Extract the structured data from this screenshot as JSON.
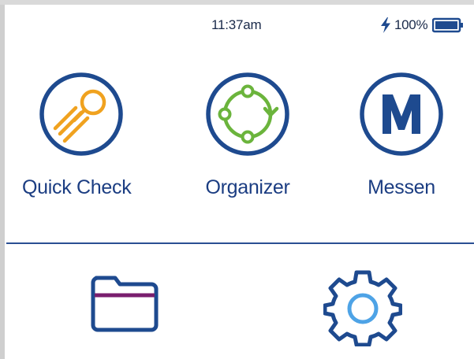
{
  "status_bar": {
    "time": "11:37am",
    "battery_percent": "100%",
    "battery_level": 1.0,
    "charging_icon": "lightning-bolt-icon",
    "battery_icon": "battery-full-icon"
  },
  "apps": [
    {
      "label": "Quick Check",
      "icon": "quick-check-rocket-icon"
    },
    {
      "label": "Organizer",
      "icon": "organizer-cycle-icon"
    },
    {
      "label": "Messen",
      "icon": "messen-m-icon"
    }
  ],
  "bottom_icons": [
    {
      "icon": "folder-icon"
    },
    {
      "icon": "gear-icon"
    }
  ],
  "colors": {
    "primary_blue": "#1e4a8f",
    "accent_orange": "#f0a21f",
    "accent_green": "#6bb43c",
    "accent_purple": "#7a1e6e",
    "accent_light_blue": "#4ea3e6",
    "bolt_blue": "#1e4a8f"
  }
}
